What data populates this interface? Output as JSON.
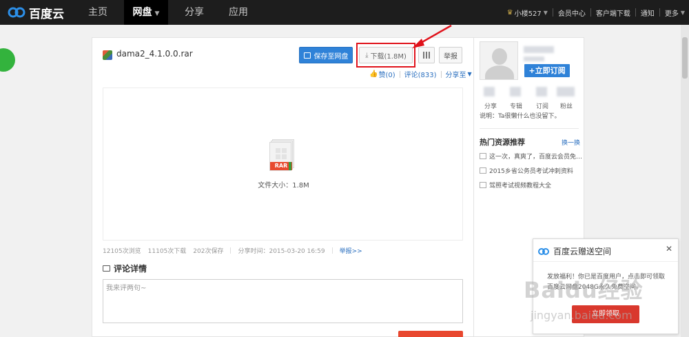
{
  "topbar": {
    "logo_text": "百度云",
    "nav": [
      "主页",
      "网盘",
      "分享",
      "应用"
    ],
    "user": "小楼527",
    "links": [
      "会员中心",
      "客户端下载",
      "通知",
      "更多"
    ]
  },
  "file": {
    "name": "dama2_4.1.0.0.rar",
    "save_label": "保存至网盘",
    "download_label": "下载(1.8M)",
    "report_label": "举报",
    "like_label": "赞(0)",
    "comment_label": "评论(833)",
    "share_label": "分享至",
    "rar_label": "RAR",
    "size_text": "文件大小：1.8M",
    "stats": {
      "views": "12105次浏览",
      "downloads": "11105次下载",
      "saves": "202次保存",
      "share_time": "分享时间：2015-03-20 16:59",
      "report_link": "举报>>"
    }
  },
  "comments": {
    "title": "评论详情",
    "placeholder": "我来评两句~"
  },
  "sidebar": {
    "subscribe_label": "+立即订阅",
    "counters": [
      "分享",
      "专辑",
      "订阅",
      "粉丝"
    ],
    "description": "说明：Ta很懒什么也没留下。",
    "hot_title": "热门资源推荐",
    "hot_switch": "换一换",
    "hot_items": [
      "这一次，真爽了，百度云会员免…",
      "2015乡省公务员考试冲刺资料",
      "驾照考试视频教程大全"
    ]
  },
  "popup": {
    "title": "百度云赠送空间",
    "text": "发放福利！你已是百度用户，点击即可领取百度云网盘2048G永久免费空间。",
    "button": "立即领取"
  },
  "watermark": {
    "main": "Baidu经验",
    "sub": "jingyan.baidu.com"
  },
  "colors": {
    "accent": "#2f82d8",
    "highlight": "#e0121b",
    "topbar": "#1d1d1d"
  }
}
